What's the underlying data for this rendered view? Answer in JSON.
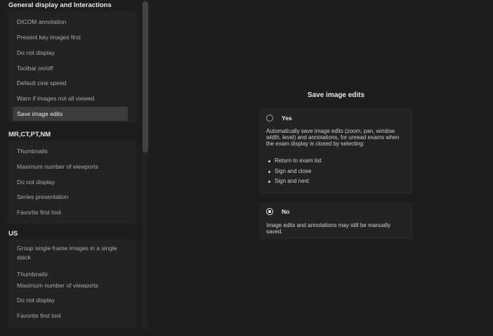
{
  "sections": [
    {
      "title": "General display and Interactions",
      "items": [
        "DICOM annotation",
        "Present key images first",
        "Do not display",
        "Toolbar on/off",
        "Default cine speed",
        "Warn if images not all viewed",
        "Save image edits"
      ],
      "selected_item": "Save image edits"
    },
    {
      "title": "MR,CT,PT,NM",
      "items": [
        "Thumbnails",
        "Maximum number of viewports",
        "Do not display",
        "Series presentation",
        "Favorite first tool"
      ]
    },
    {
      "title": "US",
      "items": [
        "Group single frame images in a single stack",
        "Thumbnails",
        "Maximum number of viewports",
        "Do not display",
        "Favorite first tool"
      ]
    }
  ],
  "main": {
    "title": "Save image edits",
    "options": [
      {
        "label": "Yes",
        "checked": false,
        "description": "Automatically save image edits (zoom, pan, window width, level) and annotations, for unread exams when the exam display is closed by selecting:",
        "bullets": [
          "Return to exam list",
          "Sign and close",
          "Sign and next"
        ]
      },
      {
        "label": "No",
        "checked": true,
        "description": "Image edits and annotations may still be manually saved."
      }
    ]
  },
  "colors": {
    "background": "#1d1d1d",
    "panel": "#232323",
    "selected": "#3c3c3c",
    "text": "#a9a9a9",
    "heading": "#e6e6e6"
  }
}
